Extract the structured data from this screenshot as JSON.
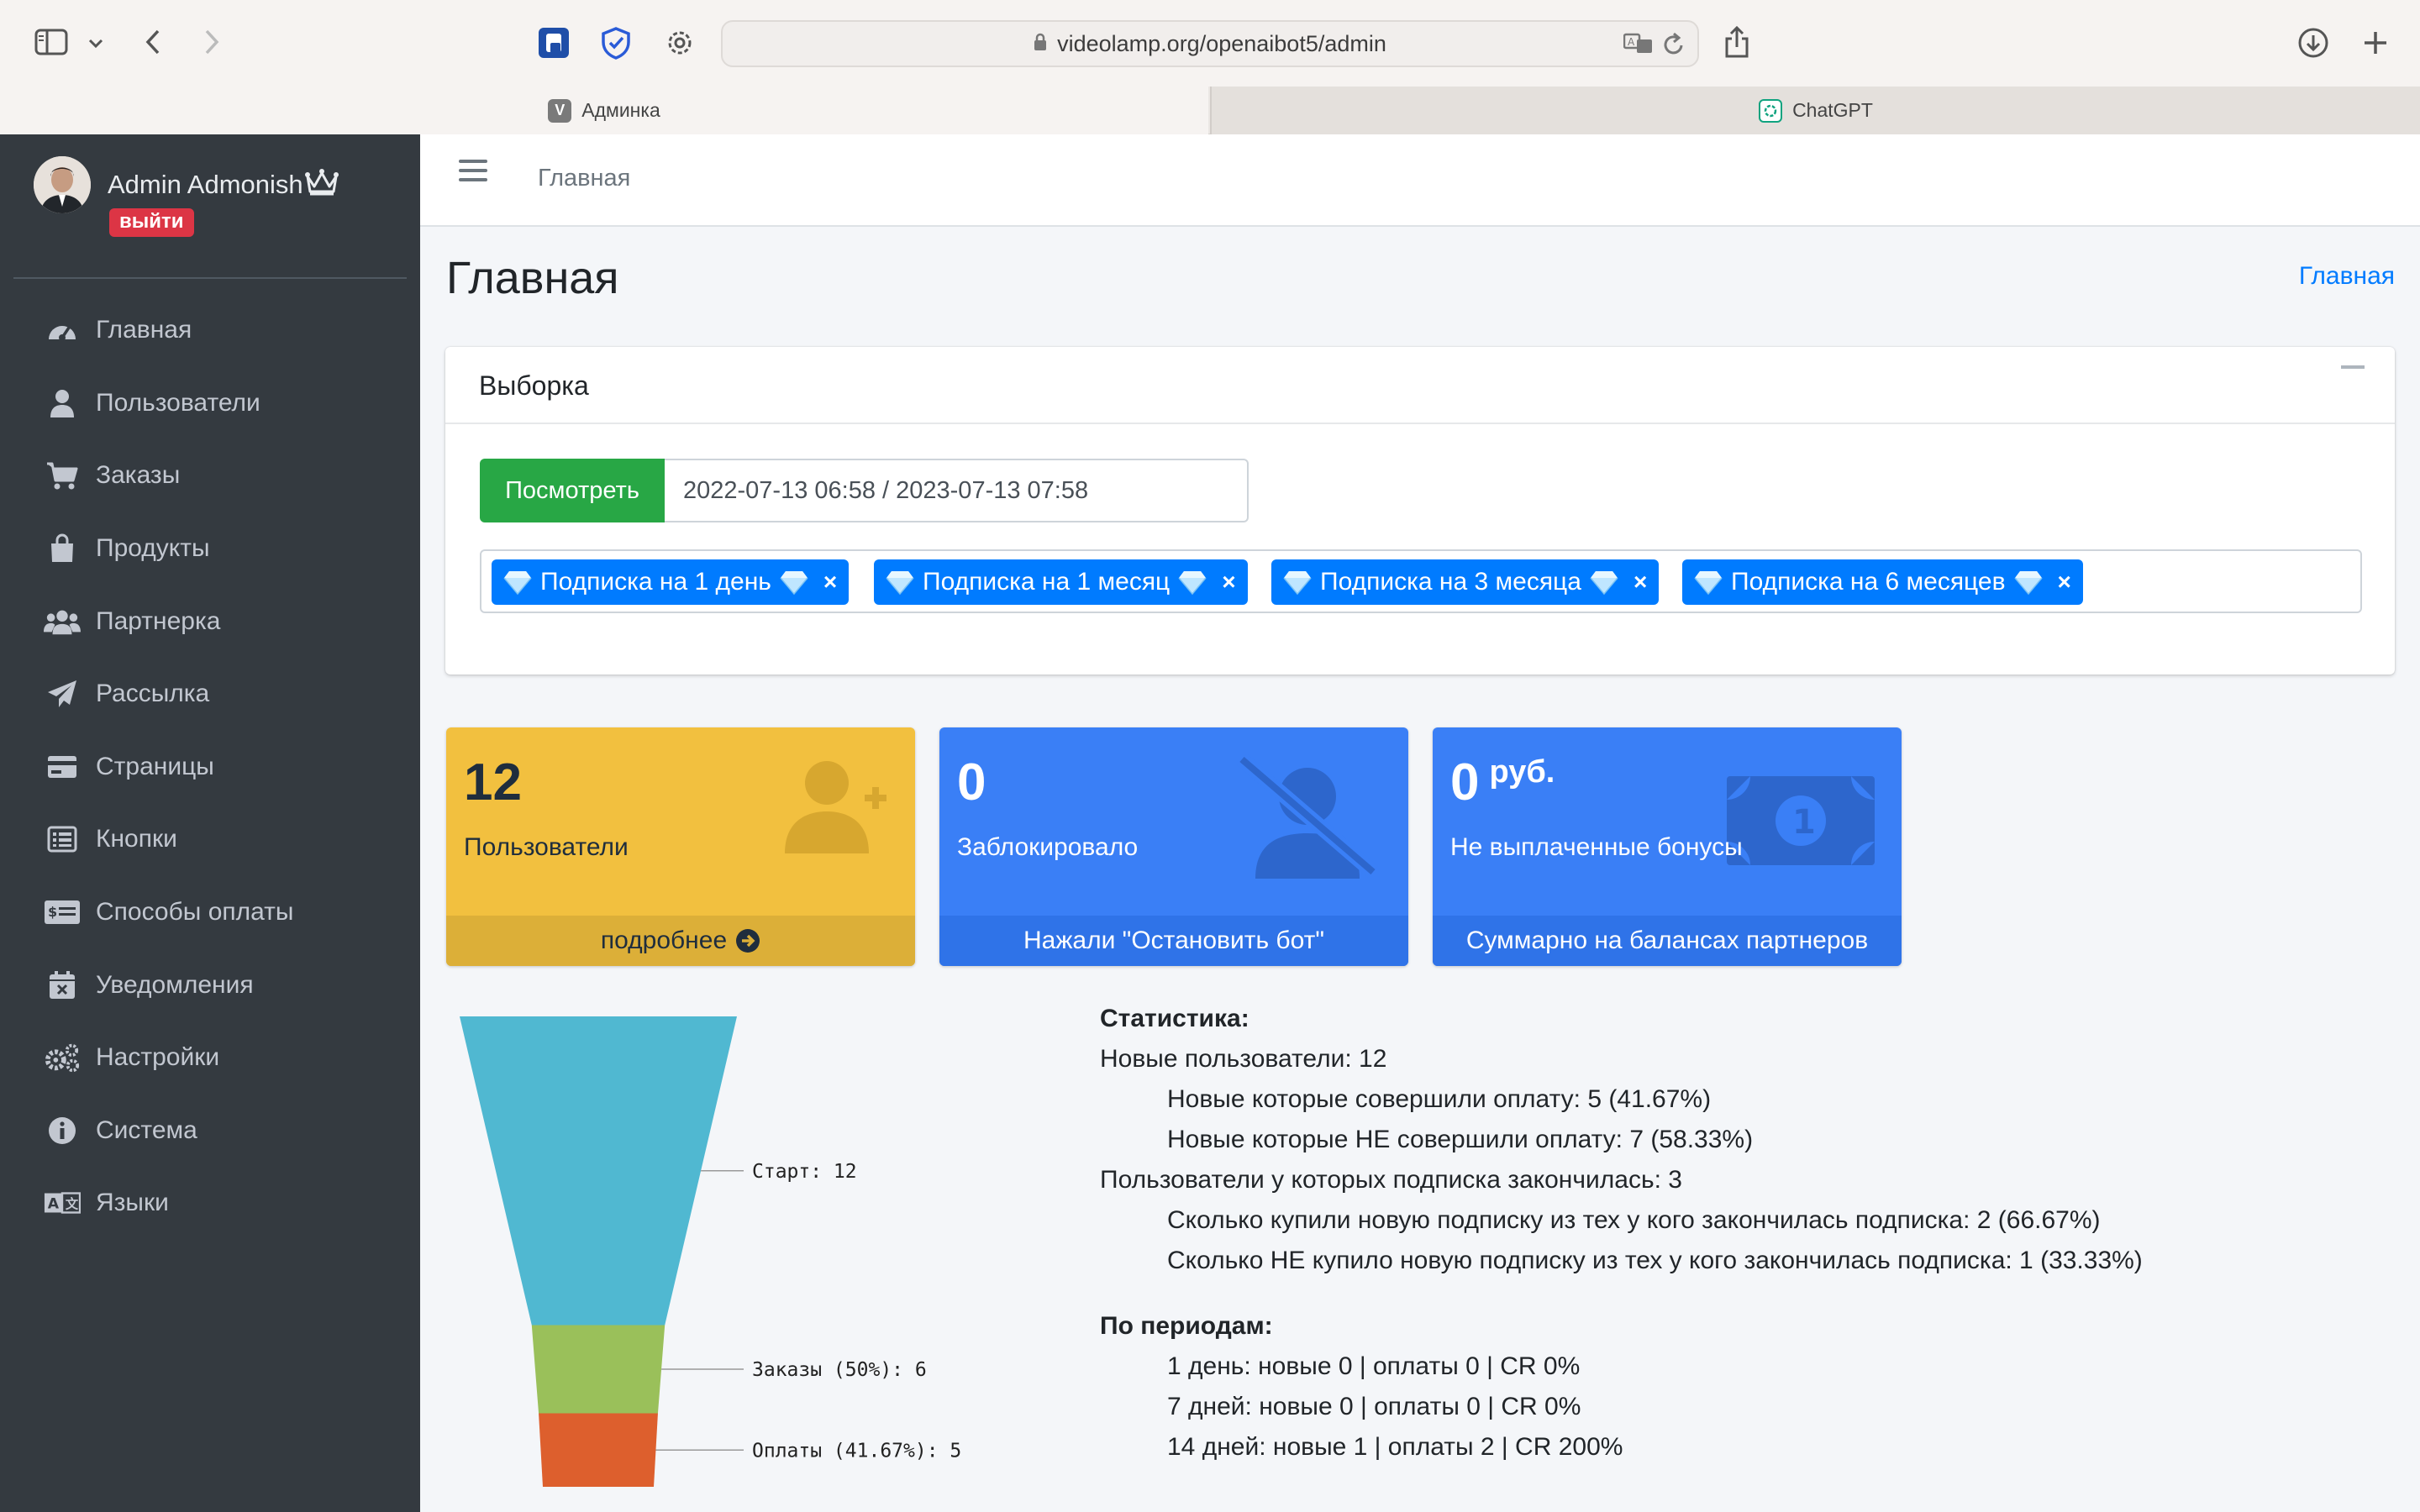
{
  "browser": {
    "url": "videolamp.org/openaibot5/admin",
    "tabs": [
      {
        "label": "Админка",
        "favicon": "V",
        "active": true
      },
      {
        "label": "ChatGPT",
        "favicon": "chatgpt-icon",
        "active": false
      }
    ]
  },
  "sidebar": {
    "user_name": "Admin Admonish",
    "logout_label": "выйти",
    "items": [
      {
        "label": "Главная",
        "icon": "dashboard-icon"
      },
      {
        "label": "Пользователи",
        "icon": "user-icon"
      },
      {
        "label": "Заказы",
        "icon": "cart-icon"
      },
      {
        "label": "Продукты",
        "icon": "bag-icon"
      },
      {
        "label": "Партнерка",
        "icon": "users-icon"
      },
      {
        "label": "Рассылка",
        "icon": "paper-plane-icon"
      },
      {
        "label": "Страницы",
        "icon": "card-icon"
      },
      {
        "label": "Кнопки",
        "icon": "list-icon"
      },
      {
        "label": "Способы оплаты",
        "icon": "money-check-icon"
      },
      {
        "label": "Уведомления",
        "icon": "calendar-times-icon"
      },
      {
        "label": "Настройки",
        "icon": "cogs-icon"
      },
      {
        "label": "Система",
        "icon": "info-icon"
      },
      {
        "label": "Языки",
        "icon": "language-icon"
      }
    ]
  },
  "header": {
    "home_link": "Главная"
  },
  "page": {
    "title": "Главная",
    "breadcrumb": "Главная"
  },
  "filter": {
    "title": "Выборка",
    "view_button": "Посмотреть",
    "daterange": "2022-07-13 06:58 / 2023-07-13 07:58",
    "tags": [
      {
        "label": "Подписка на 1 день"
      },
      {
        "label": "Подписка на 1 месяц"
      },
      {
        "label": "Подписка на 3 месяца"
      },
      {
        "label": "Подписка на 6 месяцев"
      }
    ],
    "tag_close": "×"
  },
  "boxes": {
    "users": {
      "number": "12",
      "label": "Пользователи",
      "footer": "подробнее",
      "color": "#f2c03f"
    },
    "blocked": {
      "number": "0",
      "label": "Заблокировало",
      "footer": "Нажали \"Остановить бот\"",
      "color": "#3a7ff6"
    },
    "bonus": {
      "number": "0",
      "unit": "руб.",
      "label": "Не выплаченные бонусы",
      "footer": "Суммарно на балансах партнеров",
      "color": "#3a7ff6"
    }
  },
  "chart_data": {
    "type": "funnel",
    "stages": [
      {
        "label": "Старт: 12",
        "value": 12,
        "color": "#50b8d1"
      },
      {
        "label": "Заказы (50%): 6",
        "value": 6,
        "color": "#9ac05a"
      },
      {
        "label": "Оплаты (41.67%): 5",
        "value": 5,
        "color": "#dd5f2d"
      }
    ]
  },
  "stats": {
    "heading": "Статистика:",
    "new_users": "Новые пользователи: 12",
    "new_paid": "Новые которые совершили оплату: 5 (41.67%)",
    "new_not_paid": "Новые которые НЕ совершили оплату: 7 (58.33%)",
    "expired": "Пользователи у которых подписка закончилась: 3",
    "renewed": "Сколько купили новую подписку из тех у кого закончилась подписка: 2 (66.67%)",
    "not_renewed": "Сколько НЕ купило новую подписку из тех у кого закончилась подписка: 1 (33.33%)",
    "periods_heading": "По периодам:",
    "period_1": "1 день: новые 0 | оплаты 0 | CR 0%",
    "period_7": "7 дней: новые 0 | оплаты 0 | CR 0%",
    "period_14": "14 дней: новые 1 | оплаты 2 | CR 200%"
  }
}
